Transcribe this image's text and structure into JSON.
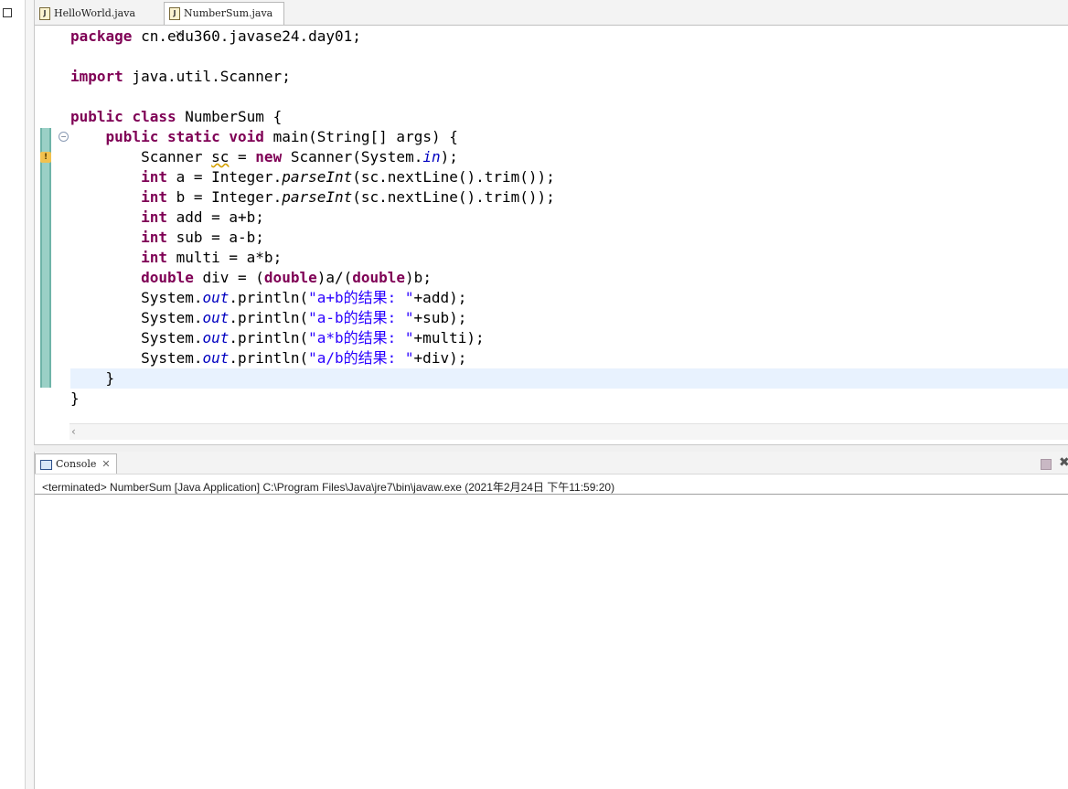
{
  "tabs": [
    {
      "label": "HelloWorld.java",
      "icon": "java-file-icon",
      "active": false
    },
    {
      "label": "NumberSum.java",
      "icon": "java-file-icon",
      "active": true,
      "closable": true
    }
  ],
  "code_lines": [
    "package cn.edu360.javase24.day01;",
    "",
    "import java.util.Scanner;",
    "",
    "public class NumberSum {",
    "    public static void main(String[] args) {",
    "        Scanner sc = new Scanner(System.in);",
    "        int a = Integer.parseInt(sc.nextLine().trim());",
    "        int b = Integer.parseInt(sc.nextLine().trim());",
    "        int add = a+b;",
    "        int sub = a-b;",
    "        int multi = a*b;",
    "        double div = (double)a/(double)b;",
    "        System.out.println(\"a+b的结果: \"+add);",
    "        System.out.println(\"a-b的结果: \"+sub);",
    "        System.out.println(\"a*b的结果: \"+multi);",
    "        System.out.println(\"a/b的结果: \"+div);",
    "    }",
    "}"
  ],
  "current_line": 18,
  "console": {
    "tab_label": "Console",
    "status": "<terminated> NumberSum [Java Application] C:\\Program Files\\Java\\jre7\\bin\\javaw.exe (2021年2月24日 下午11:59:20)"
  },
  "colors": {
    "keyword": "#7f0055",
    "string": "#2a00ff",
    "field": "#0000c0",
    "current_line_bg": "#e8f2fe",
    "ruler": "#6fb4a8"
  }
}
